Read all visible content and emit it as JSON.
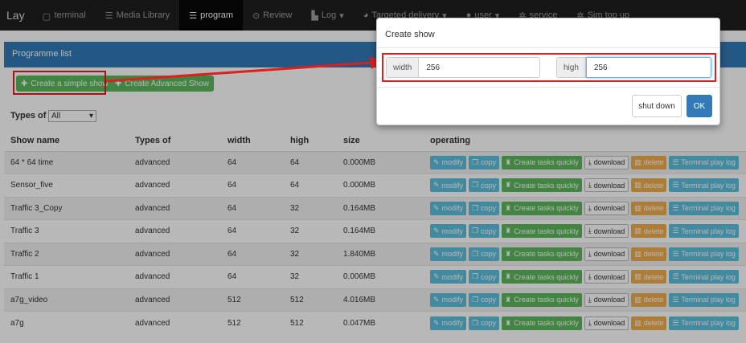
{
  "nav": {
    "brand": "Lay",
    "items": [
      {
        "label": "terminal"
      },
      {
        "label": "Media Library"
      },
      {
        "label": "program"
      },
      {
        "label": "Review"
      },
      {
        "label": "Log"
      },
      {
        "label": "Targeted delivery"
      },
      {
        "label": "user"
      },
      {
        "label": "service"
      },
      {
        "label": "Sim top up"
      }
    ]
  },
  "panel": {
    "title": "Programme list"
  },
  "toolbar": {
    "create_simple": "Create a simple show",
    "create_advanced": "Create Advanced Show",
    "types_label": "Types of",
    "types_value": "All"
  },
  "table": {
    "headers": [
      "Show name",
      "Types of",
      "width",
      "high",
      "size",
      "operating"
    ],
    "rows": [
      {
        "name": "64 * 64 time",
        "type": "advanced",
        "width": "64",
        "high": "64",
        "size": "0.000MB"
      },
      {
        "name": "Sensor_five",
        "type": "advanced",
        "width": "64",
        "high": "64",
        "size": "0.000MB"
      },
      {
        "name": "Traffic 3_Copy",
        "type": "advanced",
        "width": "64",
        "high": "32",
        "size": "0.164MB"
      },
      {
        "name": "Traffic 3",
        "type": "advanced",
        "width": "64",
        "high": "32",
        "size": "0.164MB"
      },
      {
        "name": "Traffic 2",
        "type": "advanced",
        "width": "64",
        "high": "32",
        "size": "1.840MB"
      },
      {
        "name": "Traffic 1",
        "type": "advanced",
        "width": "64",
        "high": "32",
        "size": "0.006MB"
      },
      {
        "name": "a7g_video",
        "type": "advanced",
        "width": "512",
        "high": "512",
        "size": "4.016MB"
      },
      {
        "name": "a7g",
        "type": "advanced",
        "width": "512",
        "high": "512",
        "size": "0.047MB"
      }
    ],
    "ops": {
      "modify": "modify",
      "copy": "copy",
      "tasks": "Create tasks quickly",
      "download": "download",
      "delete": "delete",
      "terminal": "Terminal play log"
    }
  },
  "modal": {
    "title": "Create show",
    "width_label": "width",
    "width_value": "256",
    "high_label": "high",
    "high_value": "256",
    "shut_down": "shut down",
    "ok": "OK"
  },
  "colors": {
    "primary": "#337ab7",
    "success": "#5cb85c",
    "info": "#5bc0de",
    "warning": "#f0ad4e",
    "highlight": "#e01e1e"
  }
}
